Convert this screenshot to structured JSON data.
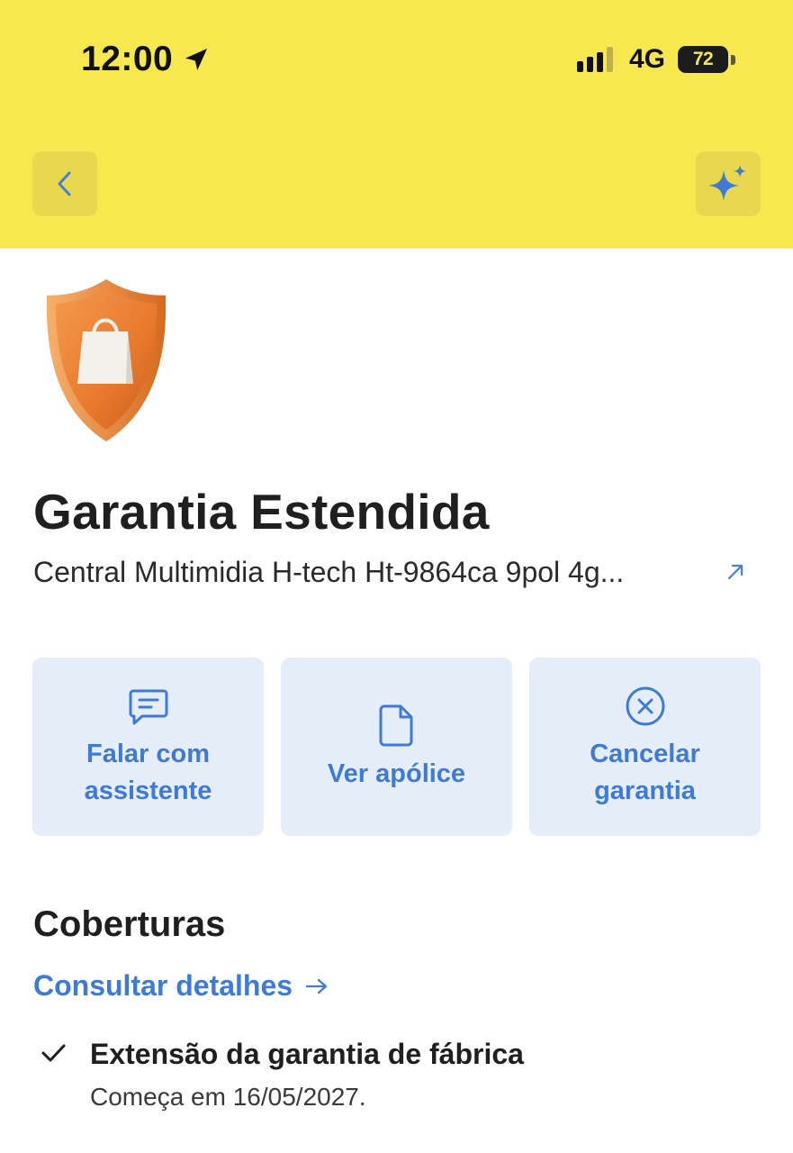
{
  "status_bar": {
    "time": "12:00",
    "network": "4G",
    "battery": "72"
  },
  "header": {
    "back_icon": "chevron-left-icon",
    "assistant_icon": "sparkle-icon",
    "colors": {
      "background": "#f8e84f",
      "button": "#e7d84e",
      "accent": "#3f7ad6"
    }
  },
  "product": {
    "image": "shield-bag-icon",
    "title": "Garantia Estendida",
    "name": "Central Multimidia H-tech Ht-9864ca 9pol 4g...",
    "link_icon": "external-link-icon"
  },
  "actions": [
    {
      "label": "Falar com\nassistente",
      "icon": "chat-icon"
    },
    {
      "label": "Ver apólice",
      "icon": "document-icon"
    },
    {
      "label": "Cancelar\ngarantia",
      "icon": "cancel-circle-icon"
    }
  ],
  "coverages": {
    "title": "Coberturas",
    "details_link": "Consultar detalhes",
    "items": [
      {
        "title": "Extensão da garantia de fábrica",
        "subtitle": "Começa em 16/05/2027."
      }
    ]
  }
}
